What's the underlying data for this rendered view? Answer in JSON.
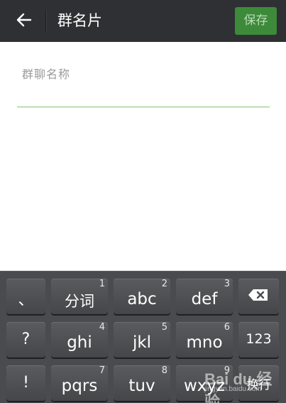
{
  "header": {
    "title": "群名片",
    "save_label": "保存"
  },
  "form": {
    "group_name_label": "群聊名称",
    "group_name_value": ""
  },
  "keyboard": {
    "row1": [
      {
        "label": "、",
        "num": ""
      },
      {
        "label": "分词",
        "num": "1"
      },
      {
        "label": "abc",
        "num": "2"
      },
      {
        "label": "def",
        "num": "3"
      },
      {
        "label": "",
        "num": "",
        "icon": "backspace-icon"
      }
    ],
    "row2": [
      {
        "label": "?",
        "num": ""
      },
      {
        "label": "ghi",
        "num": "4"
      },
      {
        "label": "jkl",
        "num": "5"
      },
      {
        "label": "mno",
        "num": "6"
      },
      {
        "label": "123",
        "num": ""
      }
    ],
    "row3": [
      {
        "label": "!",
        "num": ""
      },
      {
        "label": "pqrs",
        "num": "7"
      },
      {
        "label": "tuv",
        "num": "8"
      },
      {
        "label": "wxyz",
        "num": "9"
      },
      {
        "label": "换行",
        "num": ""
      }
    ]
  },
  "watermark": {
    "logo_text": "Bai du 经验",
    "url": "jingyan.baidu.com"
  },
  "colors": {
    "titlebar": "#2f3033",
    "save_button": "#3d8a3a",
    "input_underline": "#7cc46e",
    "keyboard_bg": "#4a4b4e"
  }
}
